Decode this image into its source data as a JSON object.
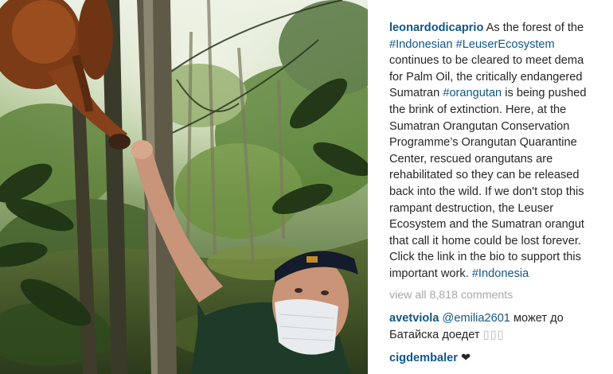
{
  "post": {
    "username": "leonardodicaprio",
    "caption": {
      "line1_text": " As the forest of the",
      "line2_tag1": "#Indonesian",
      "line2_space": " ",
      "line2_tag2": "#LeuserEcosystem",
      "line3": "continues to be cleared to meet dema",
      "line4": "for Palm Oil, the critically endangered",
      "line5_text1": "Sumatran ",
      "line5_tag": "#orangutan",
      "line5_text2": " is being pushed",
      "line6": "the brink of extinction. Here, at the",
      "line7": "Sumatran Orangutan Conservation",
      "line8": "Programme’s Orangutan Quarantine",
      "line9": "Center, rescued orangutans are",
      "line10": "rehabilitated so they can be released",
      "line11": "back into the wild. If we don't stop this",
      "line12": "rampant destruction, the Leuser",
      "line13": "Ecosystem and the Sumatran orangut",
      "line14": "that call it home could be lost forever.",
      "line15": "Click the link in the bio to support this",
      "line16_text": "important work. ",
      "line16_tag": "#Indonesia"
    },
    "view_all_comments": "view all 8,818 comments"
  },
  "comments": [
    {
      "username": "avetviola",
      "mention": "@emilia2601",
      "text_line1": " может до",
      "text_line2": "Батайска доедет ",
      "glyphs": "▯▯▯"
    },
    {
      "username": "cigdembaler",
      "text": " ❤"
    }
  ],
  "colors": {
    "link": "#125688",
    "text": "#262626",
    "muted": "#a5a7aa"
  }
}
